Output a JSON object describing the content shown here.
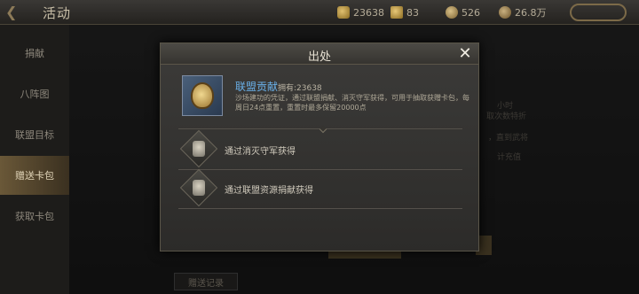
{
  "topbar": {
    "title": "活动",
    "resources": [
      {
        "icon": "gold-coin-icon",
        "value": "23638"
      },
      {
        "icon": "token-icon",
        "value": "83"
      },
      {
        "icon": "silver-icon",
        "value": "526"
      },
      {
        "icon": "copper-icon",
        "value": "26.8万"
      }
    ]
  },
  "sidebar": {
    "items": [
      {
        "label": "捐献"
      },
      {
        "label": "八阵图"
      },
      {
        "label": "联盟目标"
      },
      {
        "label": "赠送卡包"
      },
      {
        "label": "获取卡包"
      }
    ],
    "active_index": 3
  },
  "background": {
    "right_texts": [
      "小时",
      "取次数特折",
      "，直到武将",
      "计充值"
    ],
    "bottom_button": "赠送记录"
  },
  "dialog": {
    "title": "出处",
    "item": {
      "name": "联盟贡献",
      "owned": "拥有:23638",
      "description": "沙场建功的凭证，通过联盟捐献、消灭守军获得，可用于抽取获赠卡包，每周日24点重置，重置时最多保留20000点"
    },
    "sources": [
      {
        "label": "通过消灭守军获得"
      },
      {
        "label": "通过联盟资源捐献获得"
      }
    ]
  }
}
